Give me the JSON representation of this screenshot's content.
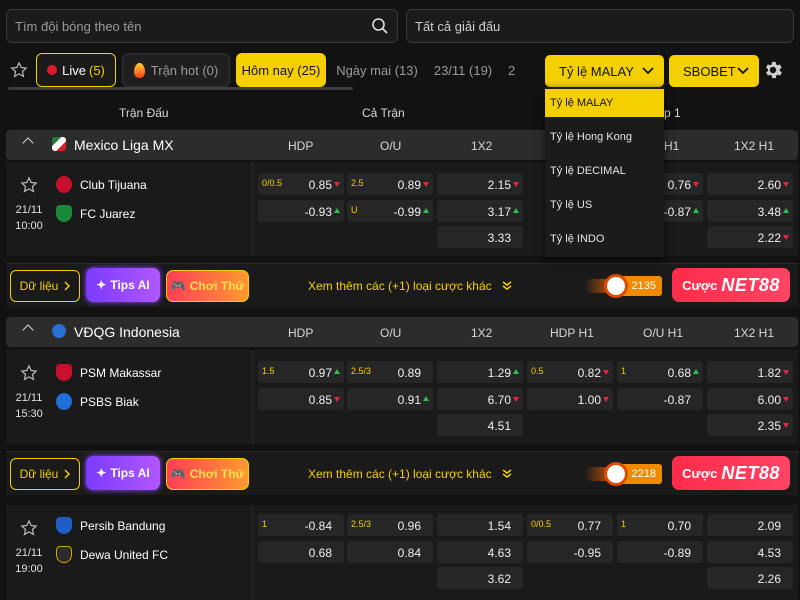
{
  "search": {
    "team_placeholder": "Tìm đội bóng theo tên",
    "league_filter": "Tất cả giải đấu"
  },
  "tabs": {
    "live": {
      "label": "Live",
      "count": "(5)"
    },
    "hot": {
      "label": "Trận hot (0)"
    },
    "today": {
      "label": "Hôm nay (25)"
    },
    "tomorrow": {
      "label": "Ngày mai (13)"
    },
    "date1": {
      "label": "23/11 (19)"
    },
    "date2": {
      "label": "2"
    }
  },
  "odds_format": {
    "selected": "Tỷ lệ MALAY",
    "options": [
      "Tỷ lệ MALAY",
      "Tỷ lệ Hong Kong",
      "Tỷ lệ DECIMAL",
      "Tỷ lệ US",
      "Tỷ lệ INDO"
    ]
  },
  "bookmaker": {
    "selected": "SBOBET"
  },
  "columns": {
    "match": "Trận Đấu",
    "full": "Cả Trận",
    "half_partial": "p 1"
  },
  "market_headers": [
    "HDP",
    "O/U",
    "1X2",
    "HDP H1",
    "O/U H1",
    "1X2 H1"
  ],
  "leagues": [
    {
      "name": "Mexico Liga MX",
      "matches": [
        {
          "date": "21/11",
          "time": "10:00",
          "home": "Club Tijuana",
          "away": "FC Juarez",
          "hdp": {
            "line": "0/0.5",
            "home": "0.85",
            "home_dir": "down",
            "away": "-0.93",
            "away_dir": "up"
          },
          "ou": {
            "line": "2.5",
            "over": "0.89",
            "over_dir": "down",
            "under_label": "U",
            "under": "-0.99",
            "under_dir": "up"
          },
          "x12": [
            "2.15",
            "3.17",
            "3.33"
          ],
          "hdp_h1": {
            "line": "",
            "home": "",
            "away": ""
          },
          "ou_h1": {
            "line": "",
            "over": "0.76",
            "over_dir": "down",
            "under": "-0.87",
            "under_dir": "up"
          },
          "x12_h1": [
            "2.60",
            "3.48",
            "2.22"
          ]
        }
      ],
      "actions": {
        "data": "Dữ liệu",
        "tips": "Tips AI",
        "play": "Chơi Thử",
        "more": "Xem thêm các (+1) loại cược khác",
        "viewers": "2135",
        "bet": "Cược",
        "brand": "NET88"
      }
    },
    {
      "name": "VĐQG Indonesia",
      "matches": [
        {
          "date": "21/11",
          "time": "15:30",
          "home": "PSM Makassar",
          "away": "PSBS Biak",
          "hdp": {
            "line": "1.5",
            "home": "0.97",
            "home_dir": "up",
            "away": "0.85",
            "away_dir": "down"
          },
          "ou": {
            "line": "2.5/3",
            "over": "0.89",
            "over_dir": "",
            "under_label": "",
            "under": "0.91",
            "under_dir": "up"
          },
          "x12": [
            "1.29",
            "6.70",
            "4.51"
          ],
          "hdp_h1": {
            "line": "0.5",
            "home": "0.82",
            "home_dir": "down",
            "away": "1.00",
            "away_dir": "down"
          },
          "ou_h1": {
            "line": "1",
            "over": "0.68",
            "over_dir": "up",
            "under": "-0.87",
            "under_dir": ""
          },
          "x12_h1": [
            "1.82",
            "6.00",
            "2.35"
          ]
        }
      ],
      "actions": {
        "data": "Dữ liệu",
        "tips": "Tips AI",
        "play": "Chơi Thử",
        "more": "Xem thêm các (+1) loại cược khác",
        "viewers": "2218",
        "bet": "Cược",
        "brand": "NET88"
      }
    },
    {
      "matches": [
        {
          "date": "21/11",
          "time": "19:00",
          "home": "Persib Bandung",
          "away": "Dewa United FC",
          "hdp": {
            "line": "1",
            "home": "-0.84",
            "away": "0.68"
          },
          "ou": {
            "line": "2.5/3",
            "over": "0.96",
            "under": "0.84"
          },
          "x12": [
            "1.54",
            "4.63",
            "3.62"
          ],
          "hdp_h1": {
            "line": "0/0.5",
            "home": "0.77",
            "away": "-0.95"
          },
          "ou_h1": {
            "line": "1",
            "over": "0.70",
            "under": "-0.89"
          },
          "x12_h1": [
            "2.09",
            "4.53",
            "2.26"
          ]
        }
      ]
    }
  ],
  "colors": {
    "accent": "#f5d000",
    "down": "#e0293b",
    "up": "#2fbf4c",
    "bet": "#ff2b4a",
    "tips": "#7b3bff"
  }
}
